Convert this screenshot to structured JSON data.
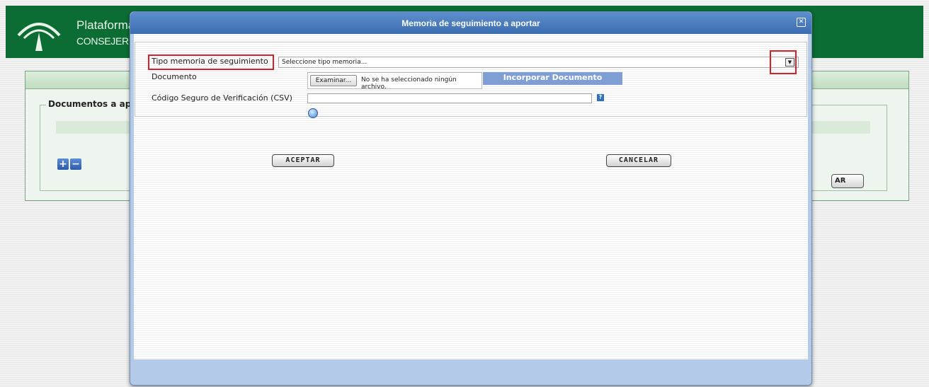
{
  "background_page": {
    "brand_title": "Plataforma",
    "brand_subtitle": "CONSEJERÍA",
    "section_legend": "Documentos a ap",
    "partial_button_label": "AR"
  },
  "modal": {
    "title": "Memoria de seguimiento a aportar",
    "fields": {
      "tipo_label": "Tipo memoria de seguimiento",
      "tipo_selected": "Seleccione tipo memoria...",
      "documento_label": "Documento",
      "file_button": "Examinar...",
      "file_status": "No se ha seleccionado ningún archivo.",
      "incorporar_button": "Incorporar Documento",
      "csv_label": "Código Seguro de Verificación (CSV)",
      "csv_value": "",
      "help_icon_glyph": "?"
    },
    "buttons": {
      "accept": "ACEPTAR",
      "cancel": "CANCELAR"
    }
  },
  "colors": {
    "header_green": "#0b6d33",
    "modal_blue": "#4a7dc0",
    "highlight_red": "#d42027"
  },
  "icons": [
    "junta-logo-icon",
    "close-icon",
    "dropdown-arrow-icon",
    "help-icon",
    "database-icon",
    "plus-icon",
    "minus-icon"
  ]
}
